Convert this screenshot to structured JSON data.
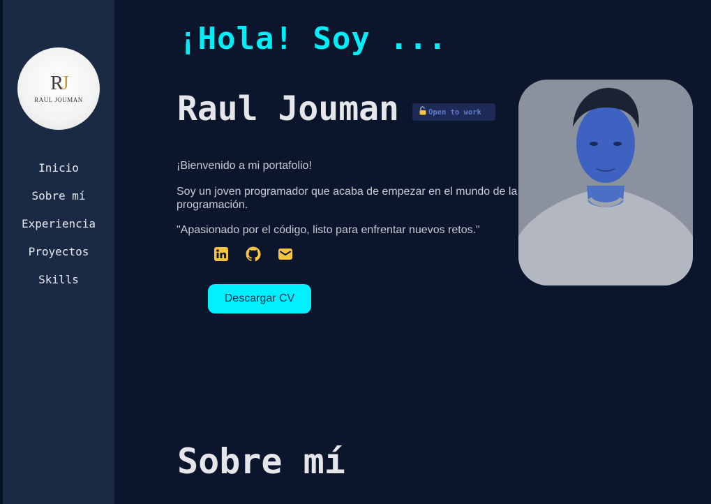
{
  "brand": {
    "logo_monogram_r": "R",
    "logo_monogram_j": "J",
    "logo_text": "RAUL JOUMAN",
    "gold": "#c79a3a"
  },
  "nav": {
    "items": [
      {
        "label": "Inicio"
      },
      {
        "label": "Sobre mí"
      },
      {
        "label": "Experiencia"
      },
      {
        "label": "Proyectos"
      },
      {
        "label": "Skills"
      }
    ]
  },
  "hero": {
    "greeting": "¡Hola! Soy ...",
    "name": "Raul Jouman",
    "badge": "Open to work",
    "welcome": "¡Bienvenido a mi portafolio!",
    "intro": "Soy un joven programador que acaba de empezar en el mundo de la programación.",
    "quote": "\"Apasionado por el código, listo para enfrentar nuevos retos.\"",
    "socials": [
      {
        "icon": "linkedin-icon"
      },
      {
        "icon": "github-icon"
      },
      {
        "icon": "email-icon"
      }
    ],
    "cv_button": "Descargar CV"
  },
  "about": {
    "title": "Sobre mí"
  },
  "colors": {
    "background": "#0b162c",
    "sidebar": "#1a2a45",
    "accent": "#00eef7",
    "icon": "#f6c343",
    "badge_bg": "#1d2a55",
    "badge_text": "#5f78c9"
  }
}
